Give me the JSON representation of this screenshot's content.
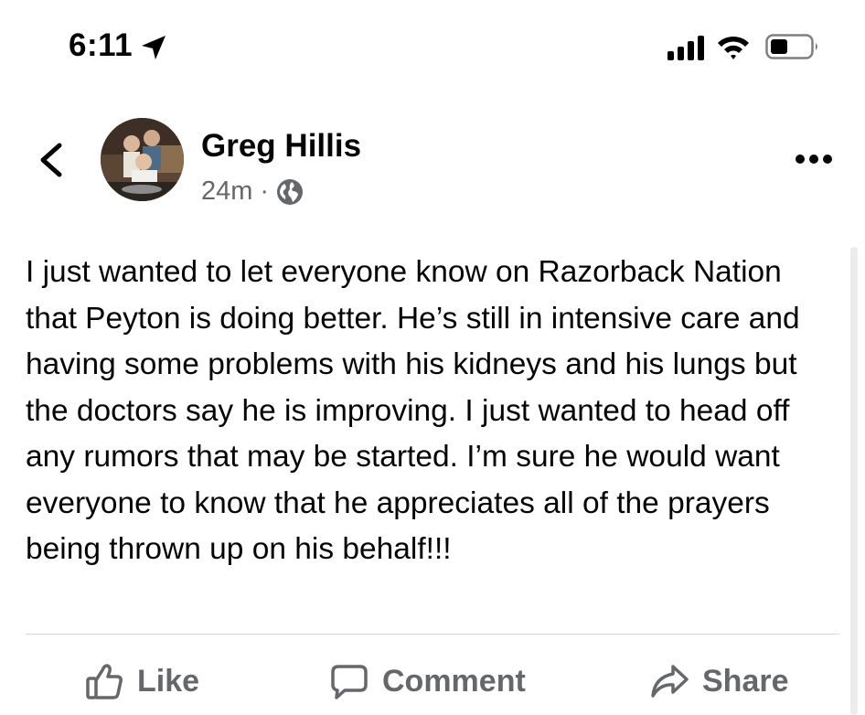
{
  "status_bar": {
    "time": "6:11"
  },
  "post": {
    "author": "Greg Hillis",
    "time_ago": "24m",
    "separator": "·",
    "privacy_icon": "globe-icon",
    "text": "I just wanted to let everyone know on Razorback Nation that Peyton is doing better. He’s still in intensive care and having some problems with his kidneys and his lungs but the doctors say he is improving. I just wanted to head off any rumors that may be started. I’m sure he would want everyone to know that he appreciates all of the prayers being thrown up on his behalf!!!"
  },
  "actions": {
    "like": "Like",
    "comment": "Comment",
    "share": "Share"
  },
  "colors": {
    "text": "#050505",
    "secondary": "#65676b",
    "divider": "#d6d8dc"
  }
}
